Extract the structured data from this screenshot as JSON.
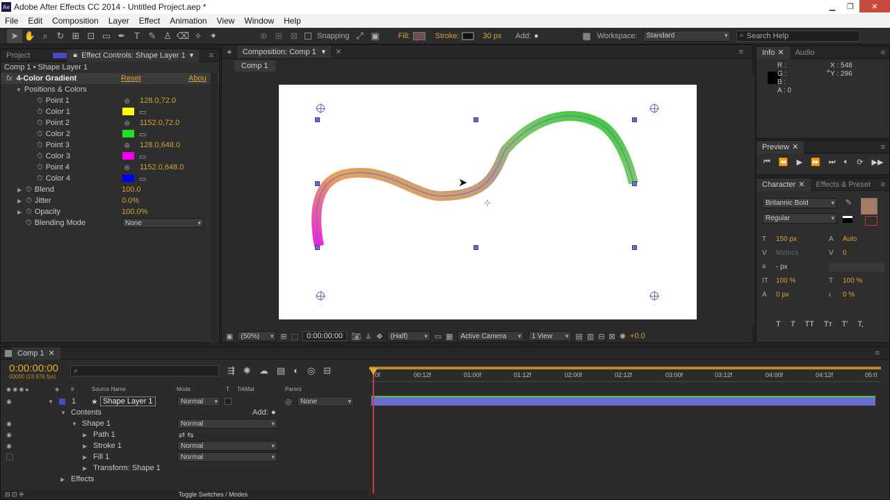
{
  "window": {
    "title": "Adobe After Effects CC 2014 - Untitled Project.aep *",
    "app_icon": "Ae"
  },
  "menus": [
    "File",
    "Edit",
    "Composition",
    "Layer",
    "Effect",
    "Animation",
    "View",
    "Window",
    "Help"
  ],
  "toolbar": {
    "snapping_label": "Snapping",
    "fill_label": "Fill:",
    "stroke_label": "Stroke:",
    "stroke_width": "30 px",
    "add_label": "Add:",
    "workspace_label": "Workspace:",
    "workspace_value": "Standard",
    "search_placeholder": "Search Help"
  },
  "left_panel": {
    "tab_project": "Project",
    "tab_effect_controls": "Effect Controls: Shape Layer 1",
    "breadcrumb": "Comp 1 • Shape Layer 1",
    "effect_name": "4-Color Gradient",
    "reset_label": "Reset",
    "about_label": "Abou",
    "group_label": "Positions & Colors",
    "props": [
      {
        "name": "Point 1",
        "value": "128.0,72.0"
      },
      {
        "name": "Color 1",
        "color": "#ffff00"
      },
      {
        "name": "Point 2",
        "value": "1152.0,72.0"
      },
      {
        "name": "Color 2",
        "color": "#22dd22"
      },
      {
        "name": "Point 3",
        "value": "128.0,648.0"
      },
      {
        "name": "Color 3",
        "color": "#ee00ee"
      },
      {
        "name": "Point 4",
        "value": "1152.0,648.0"
      },
      {
        "name": "Color 4",
        "color": "#0000ee"
      }
    ],
    "blend": {
      "name": "Blend",
      "value": "100.0"
    },
    "jitter": {
      "name": "Jitter",
      "value": "0.0%"
    },
    "opacity": {
      "name": "Opacity",
      "value": "100.0%"
    },
    "blending_mode": {
      "name": "Blending Mode",
      "value": "None"
    }
  },
  "comp_panel": {
    "tab_label": "Composition: Comp 1",
    "sub_tab": "Comp 1",
    "zoom": "(50%)",
    "timecode": "0:00:00:00",
    "resolution": "(Half)",
    "camera": "Active Camera",
    "views": "1 View",
    "exposure": "+0.0"
  },
  "info_panel": {
    "tab_info": "Info",
    "tab_audio": "Audio",
    "r": "R :",
    "g": "G :",
    "b": "B :",
    "a": "A : 0",
    "x": "X : 548",
    "y": "Y : 296"
  },
  "preview_panel": {
    "tab_label": "Preview"
  },
  "character_panel": {
    "tab_label": "Character",
    "tab2_label": "Effects & Preset",
    "font": "Britannic Bold",
    "style": "Regular",
    "size": "150 px",
    "leading": "Auto",
    "kerning": "Metrics",
    "tracking": "0",
    "stroke_width": "- px",
    "vscale": "100 %",
    "hscale": "100 %",
    "baseline": "0 px",
    "tsume": "0 %",
    "fill_color": "#a57b63"
  },
  "timeline": {
    "tab_label": "Comp 1",
    "timecode": "0:00:00:00",
    "fps": "00000 (23.976 fps)",
    "search_placeholder": "",
    "col_num": "#",
    "col_source": "Source Name",
    "col_mode": "Mode",
    "col_t": "T",
    "col_trkmat": "TrkMat",
    "col_parent": "Parent",
    "layer": {
      "num": "1",
      "name": "Shape Layer 1",
      "mode": "Normal",
      "parent": "None"
    },
    "contents_label": "Contents",
    "add_label": "Add:",
    "shape_label": "Shape 1",
    "shape_mode": "Normal",
    "path_label": "Path 1",
    "stroke_label": "Stroke 1",
    "stroke_mode": "Normal",
    "fill_label": "Fill 1",
    "fill_mode": "Normal",
    "transform_label": "Transform: Shape 1",
    "effects_label": "Effects",
    "toggle_label": "Toggle Switches / Modes",
    "ruler": [
      "0f",
      "00:12f",
      "01:00f",
      "01:12f",
      "02:00f",
      "02:12f",
      "03:00f",
      "03:12f",
      "04:00f",
      "04:12f",
      "05:0"
    ]
  }
}
